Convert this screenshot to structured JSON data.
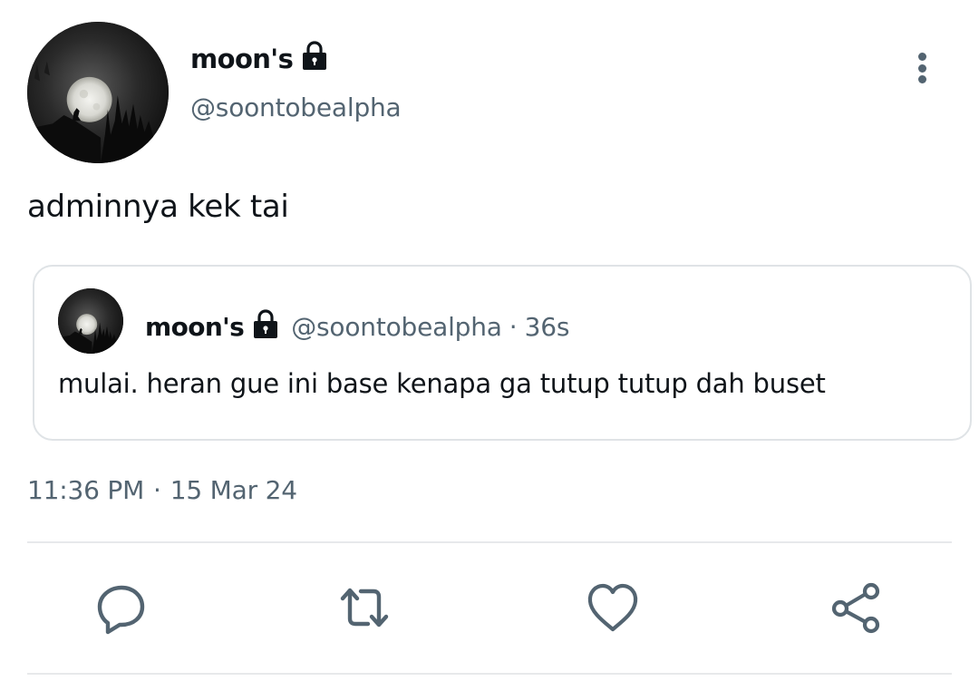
{
  "tweet": {
    "author": {
      "display_name": "moon's",
      "handle": "@soontobealpha",
      "protected_icon": "lock-icon"
    },
    "text": "adminnya kek tai",
    "timestamp": {
      "time": "11:36 PM",
      "separator": "·",
      "date": "15 Mar 24"
    }
  },
  "quote": {
    "display_name": "moon's",
    "handle": "@soontobealpha",
    "separator": "·",
    "relative_time": "36s",
    "text": "mulai. heran gue ini base kenapa ga tutup tutup dah buset"
  },
  "actions": [
    {
      "name": "reply",
      "icon": "reply-icon"
    },
    {
      "name": "retweet",
      "icon": "retweet-icon"
    },
    {
      "name": "like",
      "icon": "heart-icon"
    },
    {
      "name": "share",
      "icon": "share-icon"
    }
  ],
  "colors": {
    "text_primary": "#0f1419",
    "text_secondary": "#536471",
    "border": "#dfe3e6",
    "icon": "#536471"
  }
}
